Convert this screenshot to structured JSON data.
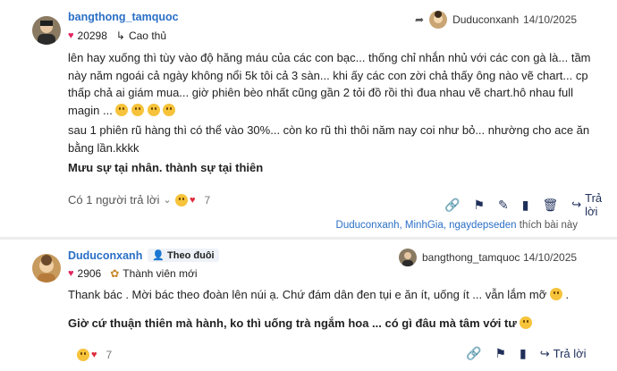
{
  "post1": {
    "username": "bangthong_tamquoc",
    "likes": "20298",
    "rank": "Cao thủ",
    "reply_to_user": "Duducon­xanh",
    "date": "14/10/2025",
    "para1": "lên hay xuống thì tùy vào độ hăng máu của các con bạc... thống chỉ nhắn nhủ với các con gà là... tầm này năm ngoái cả ngày không nổi 5k tôi cả 3 sàn... khi ấy các con zời chả thấy ông nào vẽ chart... cp thấp chả ai giám mua... giờ phiên bèo nhất cũng gần 2 tỏi đồ rồi thì đua nhau vẽ chart.hô nhau full magin ...",
    "para2": "sau 1 phiên rũ hàng thì có thể vào 30%... còn ko rũ thì thôi năm nay coi như bỏ... nhường cho ace ăn bằng lần.kkkk",
    "para3": "Mưu sự tại nhân. thành sự tại thiên",
    "replies_label": "Có 1 người trả lời",
    "reaction_count": "7",
    "reply_label": "Trả lời",
    "liked_by": "Duduconxanh, MinhGia, ngaydepseden",
    "liked_suffix": "thích bài này"
  },
  "post2": {
    "username": "Duduconxanh",
    "follow_label": "Theo đuôi",
    "likes": "2906",
    "rank": "Thành viên mới",
    "reply_to_user": "bangthong_tamquoc",
    "date": "14/10/2025",
    "para1": "Thank bác . Mời bác theo đoàn lên núi ạ. Chứ đám dân đen tụi e ăn ít, uống ít ... vẫn lắm mỡ",
    "para2": "Giờ cứ thuận thiên mà hành, ko thì uống trà ngắm hoa ... có gì đâu mà tâm với tư",
    "reaction_count": "7",
    "reply_label": "Trả lời"
  },
  "colors": {
    "link": "#2a6fc6",
    "heart": "#e0245e",
    "action": "#1f2f5a"
  }
}
